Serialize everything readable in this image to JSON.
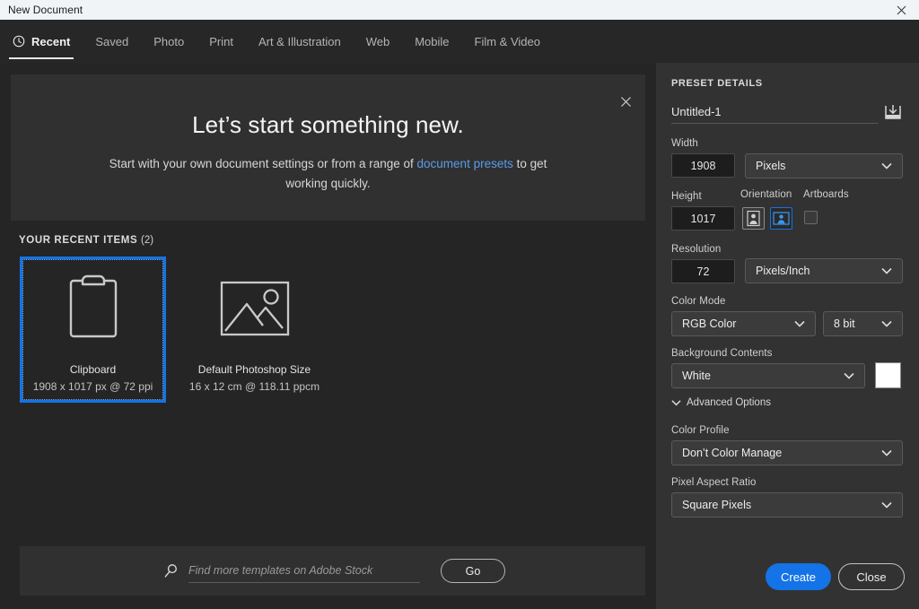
{
  "window": {
    "title": "New Document",
    "close_icon": "close-icon"
  },
  "tabs": [
    {
      "label": "Recent",
      "icon": "clock-icon",
      "active": true
    },
    {
      "label": "Saved",
      "active": false
    },
    {
      "label": "Photo",
      "active": false
    },
    {
      "label": "Print",
      "active": false
    },
    {
      "label": "Art & Illustration",
      "active": false
    },
    {
      "label": "Web",
      "active": false
    },
    {
      "label": "Mobile",
      "active": false
    },
    {
      "label": "Film & Video",
      "active": false
    }
  ],
  "banner": {
    "title": "Let’s start something new.",
    "text_before": "Start with your own document settings or from a range of ",
    "link": "document presets",
    "text_after": " to get working quickly.",
    "close_icon": "close-icon"
  },
  "recent": {
    "heading": "YOUR RECENT ITEMS",
    "count": "(2)",
    "items": [
      {
        "title": "Clipboard",
        "meta": "1908 x 1017 px @ 72 ppi",
        "icon": "clipboard-icon",
        "selected": true
      },
      {
        "title": "Default Photoshop Size",
        "meta": "16 x 12 cm @ 118.11 ppcm",
        "icon": "image-icon",
        "selected": false
      }
    ]
  },
  "search": {
    "icon": "search-icon",
    "placeholder": "Find more templates on Adobe Stock",
    "value": "",
    "go_label": "Go"
  },
  "preset": {
    "heading": "PRESET DETAILS",
    "name_value": "Untitled-1",
    "save_preset_icon": "save-preset-icon",
    "width": {
      "label": "Width",
      "value": "1908",
      "unit": "Pixels"
    },
    "height": {
      "label": "Height",
      "value": "1017"
    },
    "orientation": {
      "label": "Orientation",
      "portrait_icon": "portrait-orientation-icon",
      "landscape_icon": "landscape-orientation-icon",
      "selected": "landscape"
    },
    "artboards": {
      "label": "Artboards",
      "checked": false
    },
    "resolution": {
      "label": "Resolution",
      "value": "72",
      "unit": "Pixels/Inch"
    },
    "color_mode": {
      "label": "Color Mode",
      "value": "RGB Color",
      "depth": "8 bit"
    },
    "background": {
      "label": "Background Contents",
      "value": "White",
      "swatch_color": "#ffffff"
    },
    "advanced": {
      "label": "Advanced Options",
      "expanded": true
    },
    "color_profile": {
      "label": "Color Profile",
      "value": "Don’t Color Manage"
    },
    "pixel_aspect": {
      "label": "Pixel Aspect Ratio",
      "value": "Square Pixels"
    }
  },
  "actions": {
    "create_label": "Create",
    "close_label": "Close",
    "accent_color": "#1473e6"
  }
}
